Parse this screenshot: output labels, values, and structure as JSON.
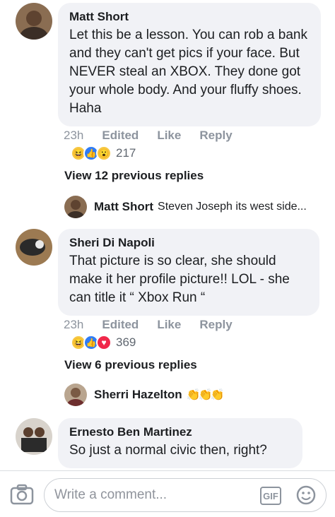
{
  "comments": [
    {
      "author": "Matt Short",
      "text": "Let this be a lesson. You can rob a bank and they can't get pics if your face. But NEVER steal an XBOX. They done got your whole body. And your fluffy shoes. Haha",
      "time": "23h",
      "edited": "Edited",
      "like": "Like",
      "reply": "Reply",
      "reactions": [
        "haha",
        "like",
        "wow"
      ],
      "reaction_count": "217",
      "view_previous": "View 12 previous replies",
      "latest_reply": {
        "author": "Matt Short",
        "text": "Steven Joseph its west side..."
      }
    },
    {
      "author": "Sheri Di Napoli",
      "text": "That picture is so clear, she should make it her profile picture!! LOL - she can title it  “ Xbox Run “",
      "time": "23h",
      "edited": "Edited",
      "like": "Like",
      "reply": "Reply",
      "reactions": [
        "haha",
        "like",
        "love"
      ],
      "reaction_count": "369",
      "view_previous": "View 6 previous replies",
      "latest_reply": {
        "author": "Sherri Hazelton",
        "text": "👏👏👏"
      }
    },
    {
      "author": "Ernesto Ben Martinez",
      "text": "So just a normal civic then, right?"
    }
  ],
  "composer": {
    "placeholder": "Write a comment...",
    "gif_label": "GIF"
  },
  "colors": {
    "bubble": "#f1f2f6",
    "meta": "#8d949e",
    "like_blue": "#2f7cf6",
    "haha_yellow": "#f7c842",
    "love_red": "#f0284a"
  }
}
